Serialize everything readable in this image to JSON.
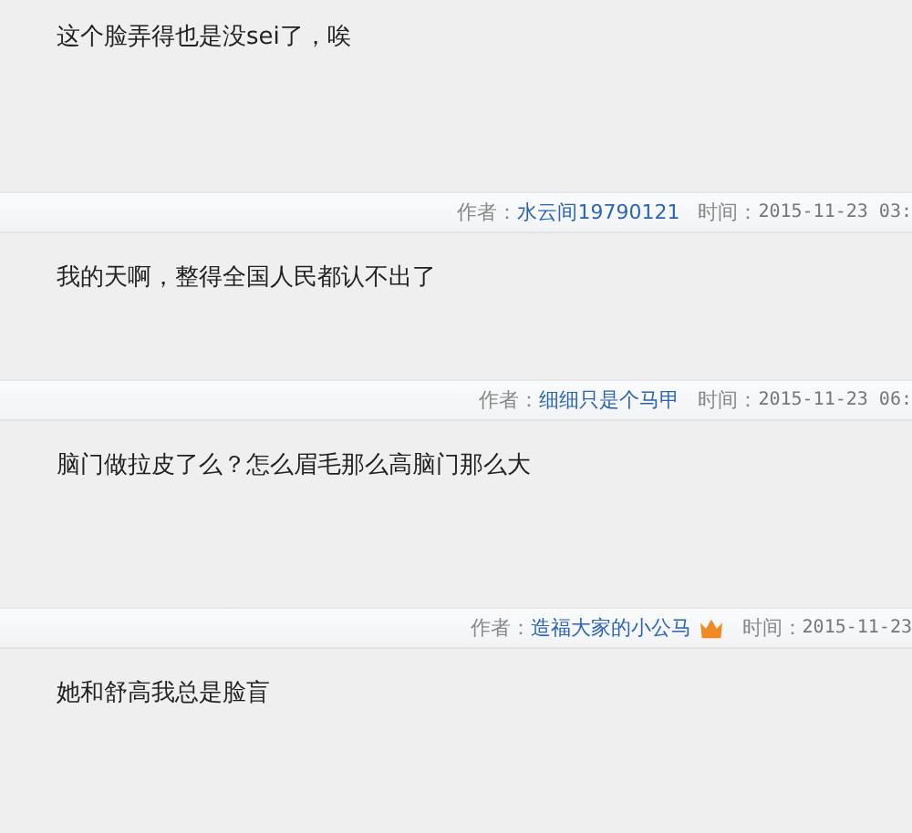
{
  "comments": [
    {
      "text": "这个脸弄得也是没sei了，唉"
    },
    {
      "author_label": "作者：",
      "author": "水云间19790121",
      "vip": false,
      "time_label": "时间：",
      "time": "2015-11-23 03:",
      "text": "我的天啊，整得全国人民都认不出了"
    },
    {
      "author_label": "作者：",
      "author": "细细只是个马甲",
      "vip": false,
      "time_label": "时间：",
      "time": "2015-11-23 06:",
      "text": "脑门做拉皮了么？怎么眉毛那么高脑门那么大"
    },
    {
      "author_label": "作者：",
      "author": "造福大家的小公马",
      "vip": true,
      "time_label": "时间：",
      "time": "2015-11-23",
      "text": "她和舒高我总是脸盲"
    }
  ]
}
